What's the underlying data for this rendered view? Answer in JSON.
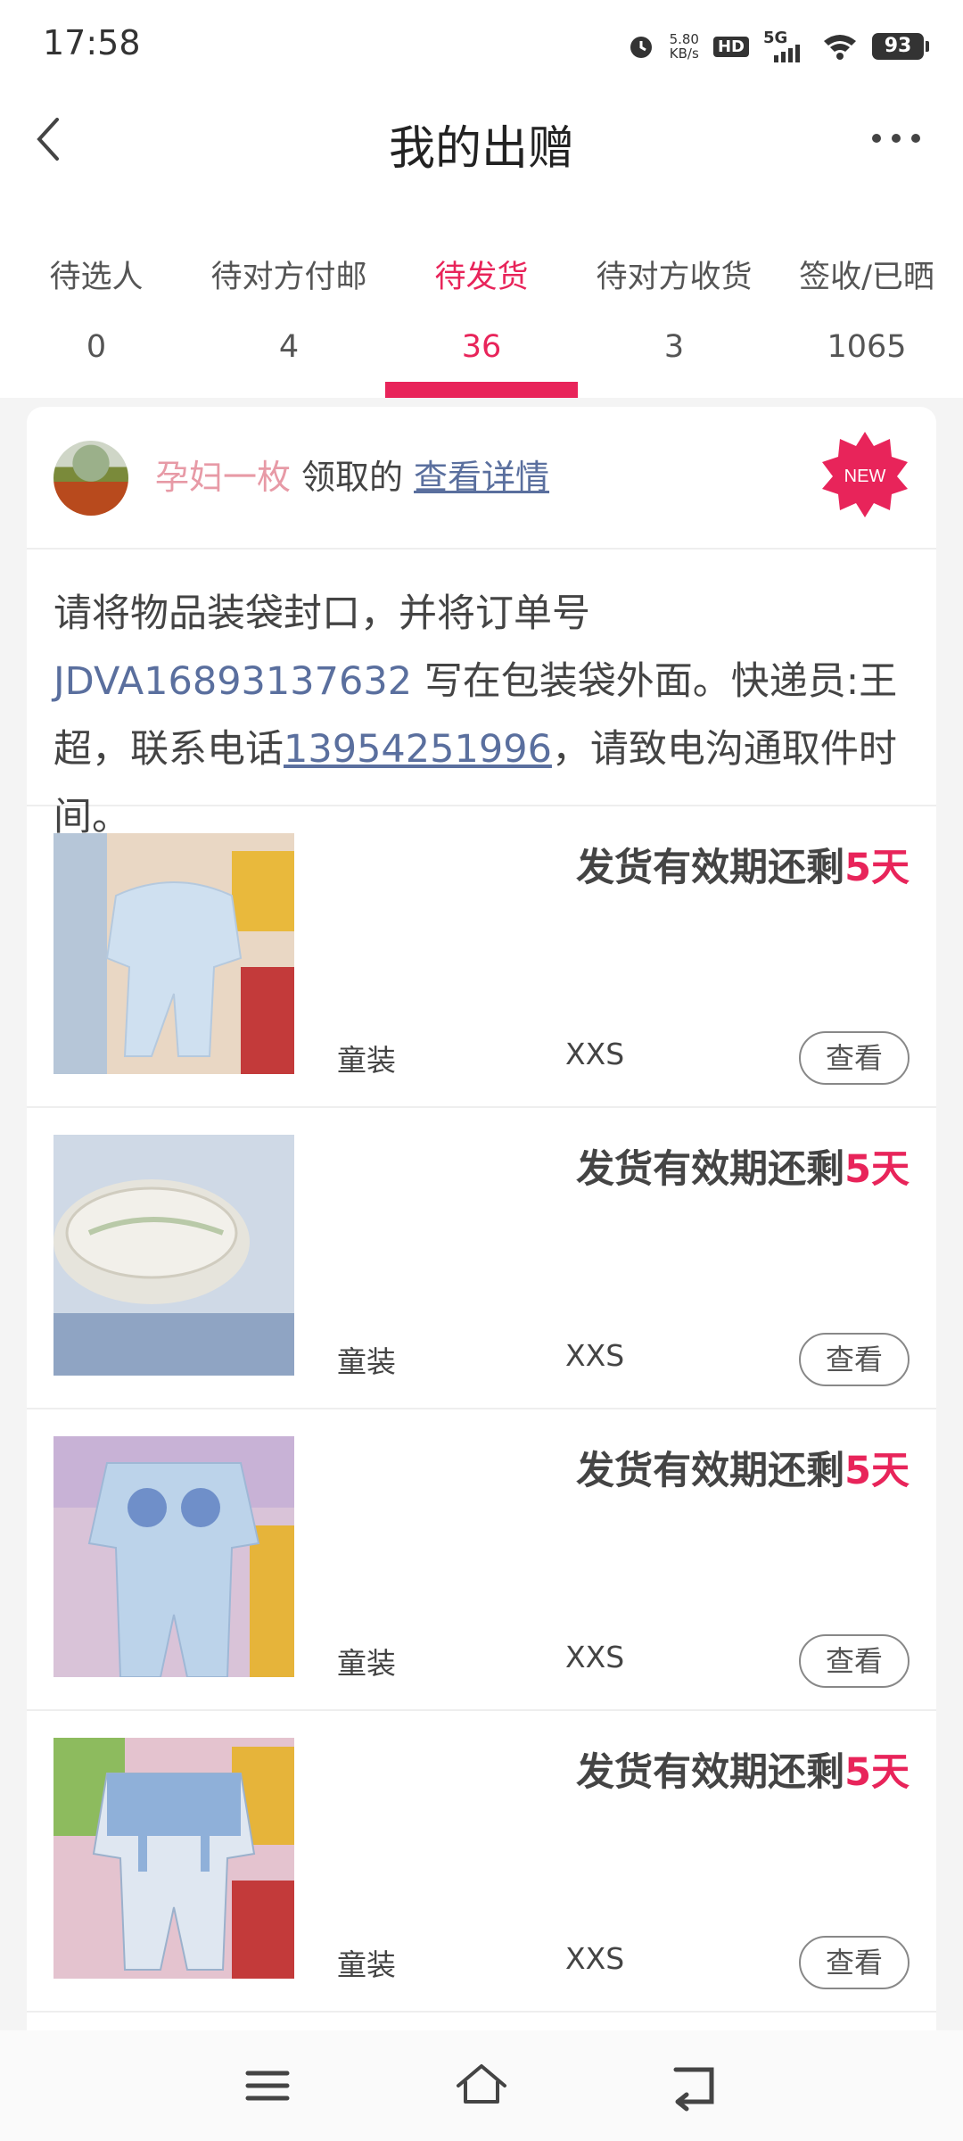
{
  "status_bar": {
    "time": "17:58",
    "net_speed_value": "5.80",
    "net_speed_unit": "KB/s",
    "hd_badge": "HD",
    "network": "5G",
    "battery": "93"
  },
  "header": {
    "title": "我的出赠"
  },
  "tabs": [
    {
      "label": "待选人",
      "count": "0",
      "active": false
    },
    {
      "label": "待对方付邮",
      "count": "4",
      "active": false
    },
    {
      "label": "待发货",
      "count": "36",
      "active": true
    },
    {
      "label": "待对方收货",
      "count": "3",
      "active": false
    },
    {
      "label": "签收/已晒",
      "count": "1065",
      "active": false
    }
  ],
  "order": {
    "giver_name": "孕妇一枚",
    "taken_text": "领取的",
    "detail_link": "查看详情",
    "new_badge": "NEW",
    "notice_prefix": "请将物品装袋封口，并将订单号 ",
    "order_number": "JDVA16893137632",
    "notice_middle": " 写在包装袋外面。快递员:王超，联系电话",
    "phone": "13954251996",
    "notice_suffix": "，请致电沟通取件时间。"
  },
  "items": [
    {
      "deadline_text": "发货有效期还剩",
      "days": "5天",
      "category": "童装",
      "size": "XXS",
      "button": "查看"
    },
    {
      "deadline_text": "发货有效期还剩",
      "days": "5天",
      "category": "童装",
      "size": "XXS",
      "button": "查看"
    },
    {
      "deadline_text": "发货有效期还剩",
      "days": "5天",
      "category": "童装",
      "size": "XXS",
      "button": "查看"
    },
    {
      "deadline_text": "发货有效期还剩",
      "days": "5天",
      "category": "童装",
      "size": "XXS",
      "button": "查看"
    }
  ],
  "colors": {
    "accent": "#e8245a",
    "link": "#5a6f9e",
    "giver": "#e79aa6"
  },
  "icons": {
    "back": "chevron-left-icon",
    "more": "more-dots-icon",
    "nav_menu": "menu-icon",
    "nav_home": "home-icon",
    "nav_back": "back-icon"
  }
}
